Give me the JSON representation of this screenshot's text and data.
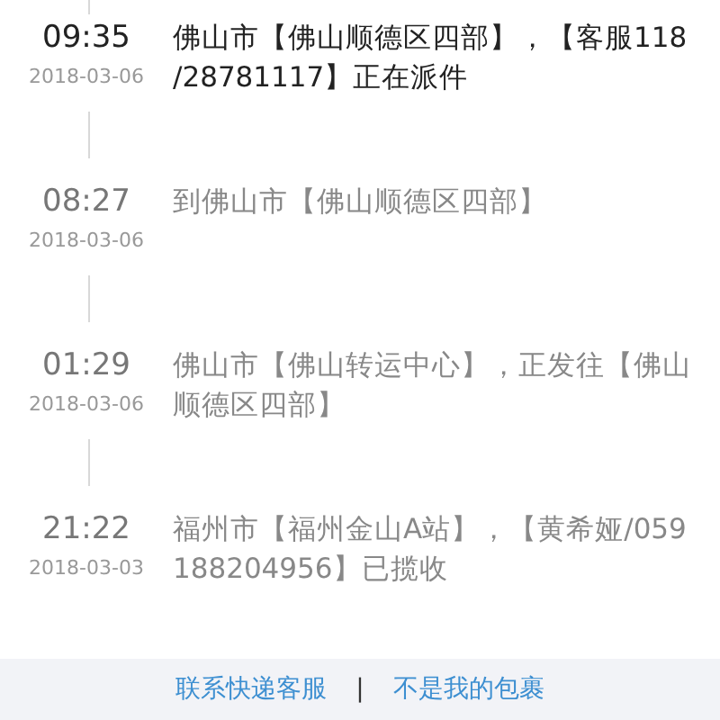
{
  "events": [
    {
      "time": "09:35",
      "date": "2018-03-06",
      "current": true,
      "lines": [
        "佛山市【佛山顺德区四部】，【客服118",
        "/28781117】正在派件"
      ]
    },
    {
      "time": "08:27",
      "date": "2018-03-06",
      "current": false,
      "lines": [
        "到佛山市【佛山顺德区四部】"
      ]
    },
    {
      "time": "01:29",
      "date": "2018-03-06",
      "current": false,
      "lines": [
        "佛山市【佛山转运中心】，正发往【佛山",
        "顺德区四部】"
      ]
    },
    {
      "time": "21:22",
      "date": "2018-03-03",
      "current": false,
      "lines": [
        "福州市【福州金山A站】，【黄希娅/059",
        "188204956】已揽收"
      ]
    }
  ],
  "footer": {
    "links": [
      "联系快递客服",
      "不是我的包裹"
    ],
    "separator": "|"
  }
}
